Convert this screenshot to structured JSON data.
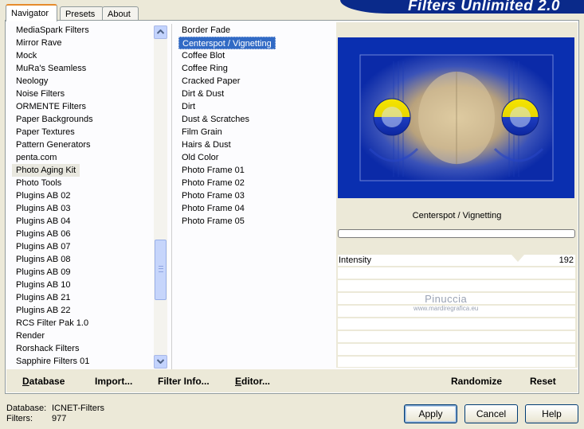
{
  "app": {
    "title": "Filters Unlimited 2.0"
  },
  "tabs": [
    {
      "label": "Navigator",
      "active": true
    },
    {
      "label": "Presets",
      "active": false
    },
    {
      "label": "About",
      "active": false
    }
  ],
  "categories": {
    "items": [
      "MediaSpark Filters",
      "Mirror Rave",
      "Mock",
      "MuRa's Seamless",
      "Neology",
      "Noise Filters",
      "ORMENTE Filters",
      "Paper Backgrounds",
      "Paper Textures",
      "Pattern Generators",
      "penta.com",
      "Photo Aging Kit",
      "Photo Tools",
      "Plugins AB 02",
      "Plugins AB 03",
      "Plugins AB 04",
      "Plugins AB 06",
      "Plugins AB 07",
      "Plugins AB 08",
      "Plugins AB 09",
      "Plugins AB 10",
      "Plugins AB 21",
      "Plugins AB 22",
      "RCS Filter Pak 1.0",
      "Render",
      "Rorshack Filters",
      "Sapphire Filters 01"
    ],
    "selected": "Photo Aging Kit"
  },
  "filters": {
    "items": [
      "Border Fade",
      "Centerspot / Vignetting",
      "Coffee Blot",
      "Coffee Ring",
      "Cracked Paper",
      "Dirt & Dust",
      "Dirt",
      "Dust & Scratches",
      "Film Grain",
      "Hairs & Dust",
      "Old Color",
      "Photo Frame 01",
      "Photo Frame 02",
      "Photo Frame 03",
      "Photo Frame 04",
      "Photo Frame 05"
    ],
    "selected": "Centerspot / Vignetting"
  },
  "preview": {
    "filter_name": "Centerspot / Vignetting"
  },
  "parameters": [
    {
      "label": "Intensity",
      "value": "192"
    }
  ],
  "watermark": {
    "line1": "Pinuccia",
    "line2": "www.mardiregrafica.eu"
  },
  "bottom_bar": {
    "database": "Database",
    "import": "Import...",
    "filter_info": "Filter Info...",
    "editor": "Editor...",
    "randomize": "Randomize",
    "reset": "Reset"
  },
  "footer": {
    "database_label": "Database:",
    "database_value": "ICNET-Filters",
    "filters_label": "Filters:",
    "filters_value": "977"
  },
  "buttons": {
    "apply": "Apply",
    "cancel": "Cancel",
    "help": "Help"
  },
  "colors": {
    "accent": "#316ac5",
    "banner": "#0a2a8a",
    "tab_highlight": "#e68b2c"
  }
}
